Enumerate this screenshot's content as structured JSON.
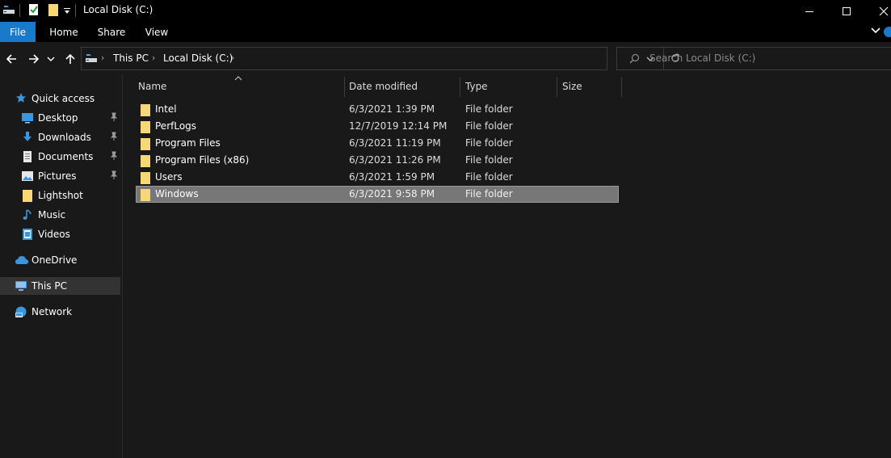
{
  "window": {
    "title": "Local Disk (C:)",
    "minimize_glyph": "—",
    "maximize_glyph": "☐",
    "close_glyph": "✕"
  },
  "ribbon": {
    "tabs": [
      "File",
      "Home",
      "Share",
      "View"
    ]
  },
  "address": {
    "crumbs": [
      "This PC",
      "Local Disk (C:)"
    ],
    "search_placeholder": "Search Local Disk (C:)"
  },
  "nav": {
    "quick_access": "Quick access",
    "items": [
      {
        "label": "Desktop",
        "icon": "desktop-icon",
        "pinned": true
      },
      {
        "label": "Downloads",
        "icon": "downloads-icon",
        "pinned": true
      },
      {
        "label": "Documents",
        "icon": "documents-icon",
        "pinned": true
      },
      {
        "label": "Pictures",
        "icon": "pictures-icon",
        "pinned": true
      },
      {
        "label": "Lightshot",
        "icon": "folder-icon",
        "pinned": false
      },
      {
        "label": "Music",
        "icon": "music-icon",
        "pinned": false
      },
      {
        "label": "Videos",
        "icon": "videos-icon",
        "pinned": false
      }
    ],
    "onedrive": "OneDrive",
    "thispc": "This PC",
    "network": "Network"
  },
  "columns": {
    "name": "Name",
    "date": "Date modified",
    "type": "Type",
    "size": "Size"
  },
  "files": [
    {
      "name": "Intel",
      "date": "6/3/2021 1:39 PM",
      "type": "File folder",
      "selected": false
    },
    {
      "name": "PerfLogs",
      "date": "12/7/2019 12:14 PM",
      "type": "File folder",
      "selected": false
    },
    {
      "name": "Program Files",
      "date": "6/3/2021 11:19 PM",
      "type": "File folder",
      "selected": false
    },
    {
      "name": "Program Files (x86)",
      "date": "6/3/2021 11:26 PM",
      "type": "File folder",
      "selected": false
    },
    {
      "name": "Users",
      "date": "6/3/2021 1:59 PM",
      "type": "File folder",
      "selected": false
    },
    {
      "name": "Windows",
      "date": "6/3/2021 9:58 PM",
      "type": "File folder",
      "selected": true
    }
  ],
  "colors": {
    "accent": "#1979ca",
    "folder": "#f8d775",
    "background": "#191919",
    "selection": "#777777"
  }
}
